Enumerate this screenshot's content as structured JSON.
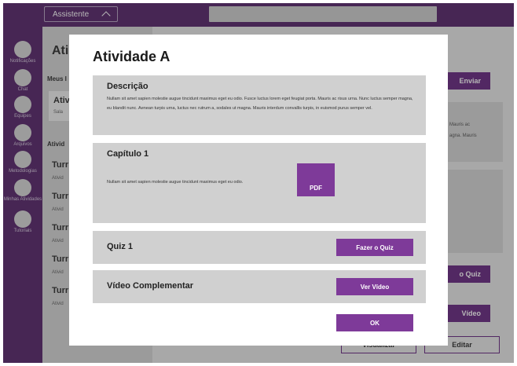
{
  "topbar": {
    "role_label": "Assistente"
  },
  "sidebar": {
    "items": [
      {
        "label": "Notificações"
      },
      {
        "label": "Chat"
      },
      {
        "label": "Equipes"
      },
      {
        "label": "Arquivos"
      },
      {
        "label": "Metodologias"
      },
      {
        "label": "Minhas Atividades"
      },
      {
        "label": "Tutoriais"
      }
    ]
  },
  "background": {
    "title": "Ati",
    "meus_label": "Meus I",
    "card_title": "Ativ",
    "card_sub": "Sala",
    "atividades_label": "Ativid",
    "rows": [
      {
        "title": "Turr",
        "sub": "Ativid"
      },
      {
        "title": "Turr",
        "sub": "Ativid"
      },
      {
        "title": "Turr",
        "sub": "Ativid"
      },
      {
        "title": "Turr",
        "sub": "Ativid"
      },
      {
        "title": "Turr",
        "sub": "Ativid"
      }
    ],
    "enviar_label": "Enviar",
    "right_text_1": "Mauris ac",
    "right_text_2": "agna. Mauris",
    "quiz_label": "o Quiz",
    "video_label": "Vídeo",
    "visualizar_label": "Visualizar",
    "editar_label": "Editar"
  },
  "modal": {
    "title": "Atividade A",
    "descricao": {
      "title": "Descrição",
      "text": "Nullam sit amet sapien molestie augue tincidunt maximus eget eu odio. Fusce luctus lorem eget feugiat porta. Mauris ac risus urna. Nunc luctus semper magna, eu blandit nunc. Aenean turpis urna, luctus nec rutrum a, sodales ut magna. Mauris interdum convallis turpis, in euismod purus semper vel."
    },
    "capitulo": {
      "title": "Capítulo 1",
      "text": "Nullam sit amet sapien molestie augue tincidunt maximus eget eu odio.",
      "pdf_label": "PDF"
    },
    "quiz": {
      "title": "Quiz 1",
      "button": "Fazer o Quiz"
    },
    "video": {
      "title": "Vídeo Complementar",
      "button": "Ver Vídeo"
    },
    "ok_label": "OK"
  },
  "colors": {
    "primary_purple": "#7e3a99",
    "sidebar_purple": "#5b2a6e",
    "section_gray": "#d0d0d0"
  }
}
